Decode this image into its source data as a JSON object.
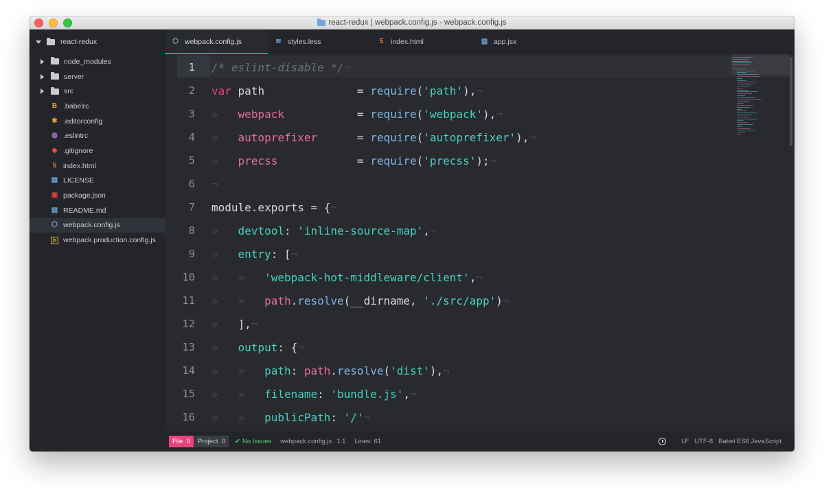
{
  "window": {
    "title": "react-redux | webpack.config.js - webpack.config.js"
  },
  "sidebar": {
    "root": "react-redux",
    "items": [
      {
        "label": "node_modules",
        "kind": "dir",
        "icon": "folder-icon"
      },
      {
        "label": "server",
        "kind": "dir",
        "icon": "folder-icon"
      },
      {
        "label": "src",
        "kind": "dir",
        "icon": "folder-icon"
      },
      {
        "label": ".babelrc",
        "kind": "file",
        "icon": "babel-icon",
        "color": "#e8a33d"
      },
      {
        "label": ".editorconfig",
        "kind": "file",
        "icon": "gear-icon",
        "color": "#e8a33d"
      },
      {
        "label": ".eslintrc",
        "kind": "file",
        "icon": "eslint-icon",
        "color": "#b07ad8"
      },
      {
        "label": ".gitignore",
        "kind": "file",
        "icon": "git-icon",
        "color": "#e8553d"
      },
      {
        "label": "index.html",
        "kind": "file",
        "icon": "html5-icon",
        "color": "#e8833d"
      },
      {
        "label": "LICENSE",
        "kind": "file",
        "icon": "book-icon",
        "color": "#6fa8dc"
      },
      {
        "label": "package.json",
        "kind": "file",
        "icon": "npm-icon",
        "color": "#d8453d"
      },
      {
        "label": "README.md",
        "kind": "file",
        "icon": "book-icon",
        "color": "#6fa8dc"
      },
      {
        "label": "webpack.config.js",
        "kind": "file",
        "icon": "webpack-icon",
        "color": "#7fb4e8",
        "selected": true
      },
      {
        "label": "webpack.production.config.js",
        "kind": "file",
        "icon": "js-icon",
        "color": "#e8c33d"
      }
    ]
  },
  "tabs": [
    {
      "label": "webpack.config.js",
      "icon": "webpack-icon",
      "color": "#7fb4e8",
      "active": true
    },
    {
      "label": "styles.less",
      "icon": "less-icon",
      "color": "#6fa8dc"
    },
    {
      "label": "index.html",
      "icon": "html5-icon",
      "color": "#e8833d"
    },
    {
      "label": "app.jsx",
      "icon": "image-icon",
      "color": "#6fa8dc"
    }
  ],
  "editor": {
    "current_line": 1,
    "lines": [
      [
        [
          "/* eslint-disable */",
          "comment"
        ],
        [
          "¬",
          "ws"
        ]
      ],
      [
        [
          "var",
          "kw"
        ],
        [
          " path              = ",
          "plain"
        ],
        [
          "require",
          "fn"
        ],
        [
          "(",
          "plain"
        ],
        [
          "'path'",
          "str"
        ],
        [
          "),",
          "plain"
        ],
        [
          "¬",
          "ws"
        ]
      ],
      [
        [
          "»   ",
          "ws"
        ],
        [
          "webpack",
          "var"
        ],
        [
          "           = ",
          "plain"
        ],
        [
          "require",
          "fn"
        ],
        [
          "(",
          "plain"
        ],
        [
          "'webpack'",
          "str"
        ],
        [
          "),",
          "plain"
        ],
        [
          "¬",
          "ws"
        ]
      ],
      [
        [
          "»   ",
          "ws"
        ],
        [
          "autoprefixer",
          "var"
        ],
        [
          "      = ",
          "plain"
        ],
        [
          "require",
          "fn"
        ],
        [
          "(",
          "plain"
        ],
        [
          "'autoprefixer'",
          "str"
        ],
        [
          "),",
          "plain"
        ],
        [
          "¬",
          "ws"
        ]
      ],
      [
        [
          "»   ",
          "ws"
        ],
        [
          "precss",
          "var"
        ],
        [
          "            = ",
          "plain"
        ],
        [
          "require",
          "fn"
        ],
        [
          "(",
          "plain"
        ],
        [
          "'precss'",
          "str"
        ],
        [
          ");",
          "plain"
        ],
        [
          "¬",
          "ws"
        ]
      ],
      [
        [
          "¬",
          "ws"
        ]
      ],
      [
        [
          "module.exports = {",
          "plain"
        ],
        [
          "¬",
          "ws"
        ]
      ],
      [
        [
          "»   ",
          "ws"
        ],
        [
          "devtool",
          "key"
        ],
        [
          ": ",
          "plain"
        ],
        [
          "'inline-source-map'",
          "str"
        ],
        [
          ",",
          "plain"
        ],
        [
          "¬",
          "ws"
        ]
      ],
      [
        [
          "»   ",
          "ws"
        ],
        [
          "entry",
          "key"
        ],
        [
          ": [",
          "plain"
        ],
        [
          "¬",
          "ws"
        ]
      ],
      [
        [
          "»   »   ",
          "ws"
        ],
        [
          "'webpack-hot-middleware/client'",
          "str"
        ],
        [
          ",",
          "plain"
        ],
        [
          "¬",
          "ws"
        ]
      ],
      [
        [
          "»   »   ",
          "ws"
        ],
        [
          "path",
          "var"
        ],
        [
          ".",
          "plain"
        ],
        [
          "resolve",
          "fn"
        ],
        [
          "(__dirname, ",
          "plain"
        ],
        [
          "'./src/app'",
          "str"
        ],
        [
          ")",
          "plain"
        ],
        [
          "¬",
          "ws"
        ]
      ],
      [
        [
          "»   ",
          "ws"
        ],
        [
          "],",
          "plain"
        ],
        [
          "¬",
          "ws"
        ]
      ],
      [
        [
          "»   ",
          "ws"
        ],
        [
          "output",
          "key"
        ],
        [
          ": {",
          "plain"
        ],
        [
          "¬",
          "ws"
        ]
      ],
      [
        [
          "»   »   ",
          "ws"
        ],
        [
          "path",
          "key"
        ],
        [
          ": ",
          "plain"
        ],
        [
          "path",
          "var"
        ],
        [
          ".",
          "plain"
        ],
        [
          "resolve",
          "fn"
        ],
        [
          "(",
          "plain"
        ],
        [
          "'dist'",
          "str"
        ],
        [
          "),",
          "plain"
        ],
        [
          "¬",
          "ws"
        ]
      ],
      [
        [
          "»   »   ",
          "ws"
        ],
        [
          "filename",
          "key"
        ],
        [
          ": ",
          "plain"
        ],
        [
          "'bundle.js'",
          "str"
        ],
        [
          ",",
          "plain"
        ],
        [
          "¬",
          "ws"
        ]
      ],
      [
        [
          "»   »   ",
          "ws"
        ],
        [
          "publicPath",
          "key"
        ],
        [
          ": ",
          "plain"
        ],
        [
          "'/'",
          "str"
        ],
        [
          "¬",
          "ws"
        ]
      ]
    ]
  },
  "statusbar": {
    "file_label": "File",
    "file_count": "0",
    "project_label": "Project",
    "project_count": "0",
    "issues": "No Issues",
    "filename": "webpack.config.js",
    "cursor": "1:1",
    "lines": "Lines: 61",
    "line_ending": "LF",
    "encoding": "UTF-8",
    "grammar": "Babel ES6 JavaScript"
  }
}
